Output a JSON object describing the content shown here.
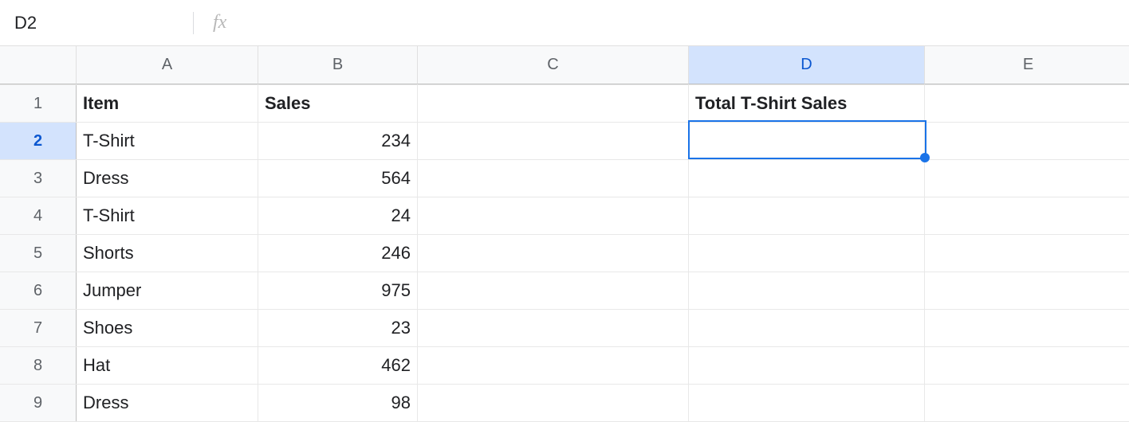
{
  "formula_bar": {
    "name_box": "D2",
    "fx_label": "fx",
    "formula": ""
  },
  "columns": [
    {
      "id": "A",
      "label": "A",
      "width_class": "col-A",
      "selected": false
    },
    {
      "id": "B",
      "label": "B",
      "width_class": "col-B",
      "selected": false
    },
    {
      "id": "C",
      "label": "C",
      "width_class": "col-C",
      "selected": false
    },
    {
      "id": "D",
      "label": "D",
      "width_class": "col-D",
      "selected": true
    },
    {
      "id": "E",
      "label": "E",
      "width_class": "col-E",
      "selected": false
    }
  ],
  "row_headers": [
    "1",
    "2",
    "3",
    "4",
    "5",
    "6",
    "7",
    "8",
    "9"
  ],
  "selected_row": "2",
  "cells": {
    "A1": "Item",
    "B1": "Sales",
    "D1": "Total T-Shirt Sales",
    "A2": "T-Shirt",
    "B2": "234",
    "A3": "Dress",
    "B3": "564",
    "A4": "T-Shirt",
    "B4": "24",
    "A5": "Shorts",
    "B5": "246",
    "A6": "Jumper",
    "B6": "975",
    "A7": "Shoes",
    "B7": "23",
    "A8": "Hat",
    "B8": "462",
    "A9": "Dress",
    "B9": "98"
  },
  "chart_data": {
    "type": "table",
    "title": "",
    "headers": [
      "Item",
      "Sales"
    ],
    "rows": [
      [
        "T-Shirt",
        234
      ],
      [
        "Dress",
        564
      ],
      [
        "T-Shirt",
        24
      ],
      [
        "Shorts",
        246
      ],
      [
        "Jumper",
        975
      ],
      [
        "Shoes",
        23
      ],
      [
        "Hat",
        462
      ],
      [
        "Dress",
        98
      ]
    ],
    "summary_label": "Total T-Shirt Sales",
    "summary_value": null
  }
}
